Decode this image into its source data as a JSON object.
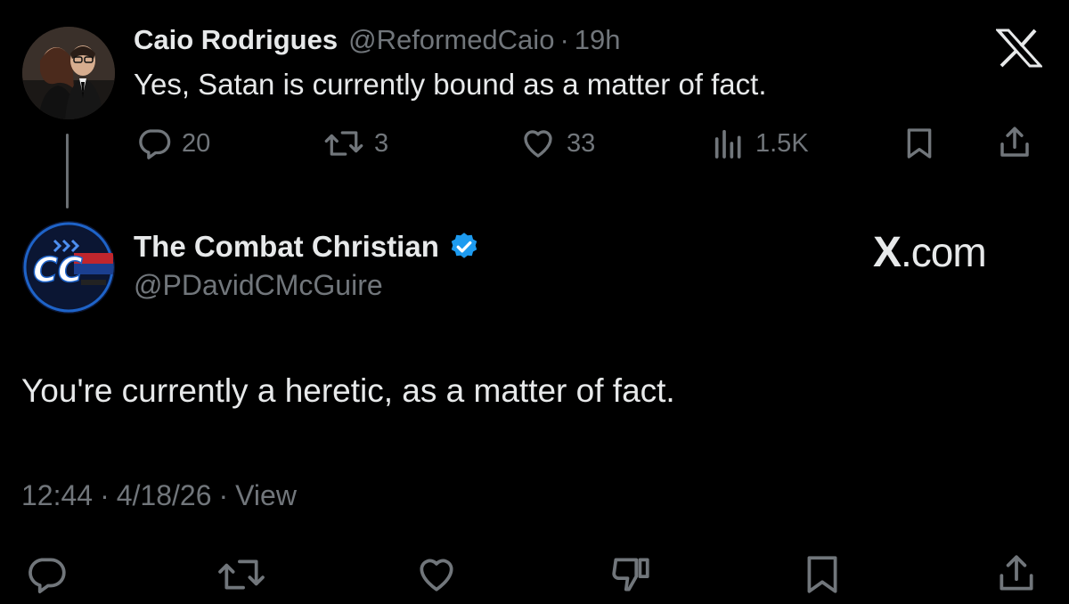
{
  "parent_tweet": {
    "name": "Caio Rodrigues",
    "handle": "@ReformedCaio",
    "separator": "·",
    "time": "19h",
    "text": "Yes, Satan is currently bound as a matter of fact.",
    "actions": {
      "replies": "20",
      "reposts": "3",
      "likes": "33",
      "views": "1.5K"
    }
  },
  "main_tweet": {
    "name": "The Combat Christian",
    "verified": true,
    "handle": "@PDavidCMcGuire",
    "text": "You're currently a heretic, as a matter of fact.",
    "time": "12:44",
    "date": "4/18/26",
    "separator": "·",
    "view_label": "View"
  },
  "watermark": {
    "x": "X",
    "domain": ".com"
  },
  "icons": {
    "top_right": "x-logo-icon",
    "reply": "reply-icon",
    "repost": "repost-icon",
    "like": "heart-icon",
    "views": "views-icon",
    "bookmark": "bookmark-icon",
    "share": "share-icon",
    "dislike": "dislike-icon"
  },
  "colors": {
    "background": "#000000",
    "text_primary": "#e7e9ea",
    "text_secondary": "#71767b",
    "verified_badge": "#1d9bf0"
  }
}
